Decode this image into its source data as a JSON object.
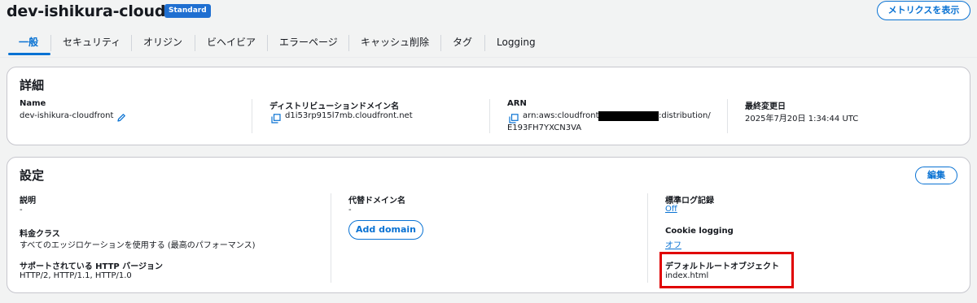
{
  "header": {
    "title": "dev-ishikura-cloudfront",
    "badge": "Standard",
    "metrics_button": "メトリクスを表示"
  },
  "tabs": [
    {
      "label": "一般",
      "active": true
    },
    {
      "label": "セキュリティ"
    },
    {
      "label": "オリジン"
    },
    {
      "label": "ビヘイビア"
    },
    {
      "label": "エラーページ"
    },
    {
      "label": "キャッシュ削除"
    },
    {
      "label": "タグ"
    },
    {
      "label": "Logging"
    }
  ],
  "details": {
    "title": "詳細",
    "name_label": "Name",
    "name_value": "dev-ishikura-cloudfront",
    "domain_label": "ディストリビューションドメイン名",
    "domain_value": "d1i53rp915l7mb.cloudfront.net",
    "arn_label": "ARN",
    "arn_prefix": "arn:aws:cloudfront::",
    "arn_suffix": ":distribution/",
    "arn_line2": "E193FH7YXCN3VA",
    "modified_label": "最終変更日",
    "modified_value": "2025年7月20日 1:34:44 UTC"
  },
  "settings": {
    "title": "設定",
    "edit_button": "編集",
    "description_label": "説明",
    "description_value": "-",
    "price_class_label": "料金クラス",
    "price_class_value": "すべてのエッジロケーションを使用する (最高のパフォーマンス)",
    "http_label": "サポートされている HTTP バージョン",
    "http_value": "HTTP/2, HTTP/1.1, HTTP/1.0",
    "alt_domain_label": "代替ドメイン名",
    "alt_domain_value": "-",
    "add_domain_button": "Add domain",
    "std_log_label": "標準ログ記録",
    "std_log_value": "Off",
    "cookie_label": "Cookie logging",
    "cookie_value": "オフ",
    "root_obj_label": "デフォルトルートオブジェクト",
    "root_obj_value": "index.html"
  },
  "colors": {
    "accent": "#0972d3",
    "highlight": "#e00000",
    "badge": "#1f6fd1"
  }
}
